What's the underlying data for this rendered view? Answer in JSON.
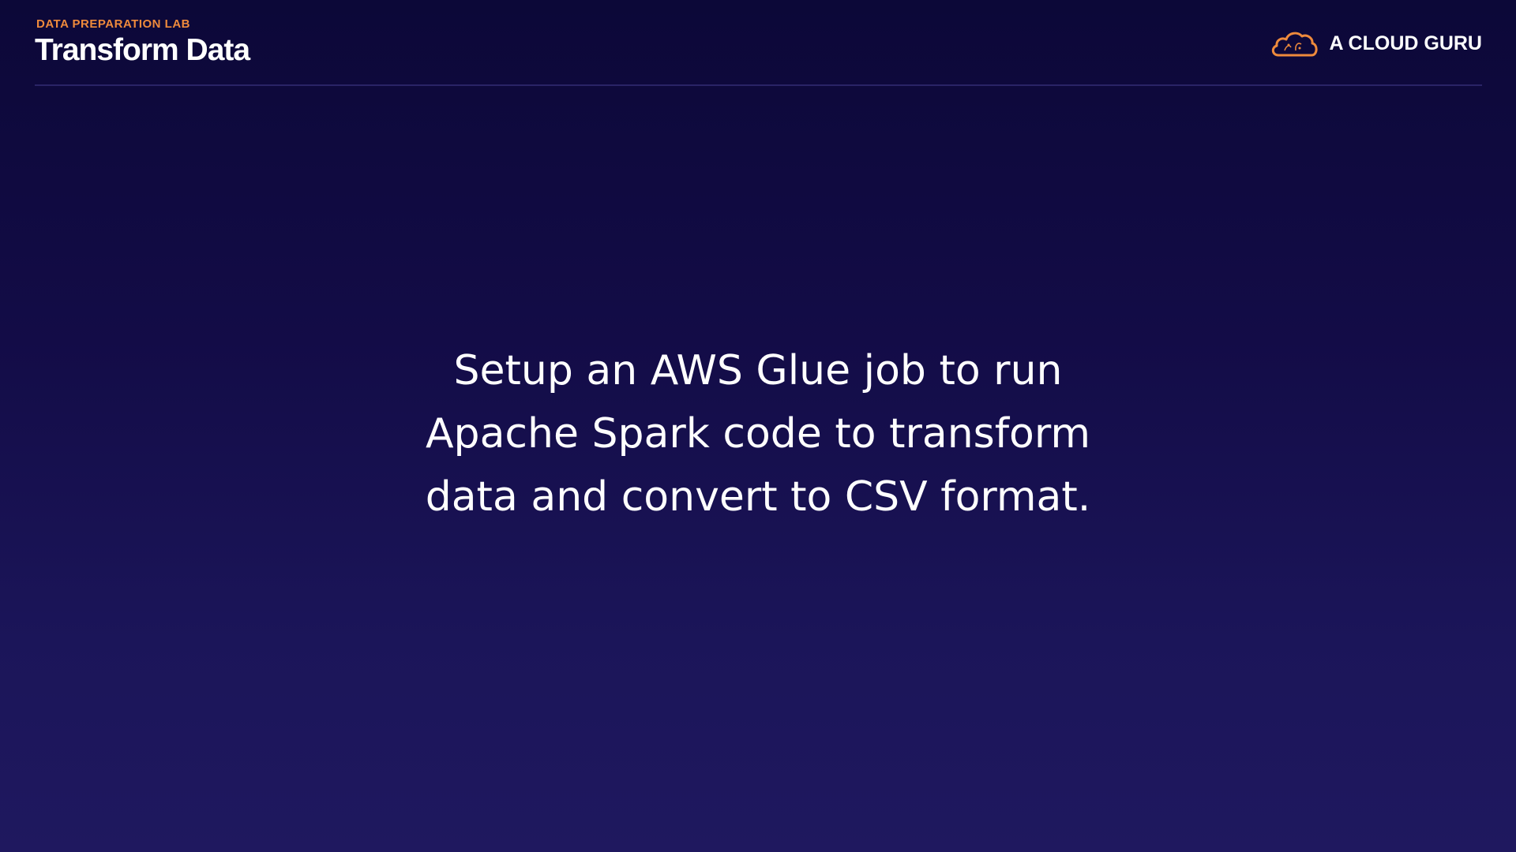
{
  "header": {
    "eyebrow": "DATA PREPARATION LAB",
    "title": "Transform Data",
    "brand_name": "A CLOUD GURU",
    "brand_icon": "cloud-logo-icon",
    "accent_color": "#ee8a3c"
  },
  "main": {
    "lines": [
      "Setup an AWS Glue job to run",
      "Apache Spark code to transform",
      "data and convert to CSV format."
    ]
  },
  "colors": {
    "background_top": "#0c0838",
    "background_bottom": "#1f185f",
    "text": "#ffffff"
  }
}
